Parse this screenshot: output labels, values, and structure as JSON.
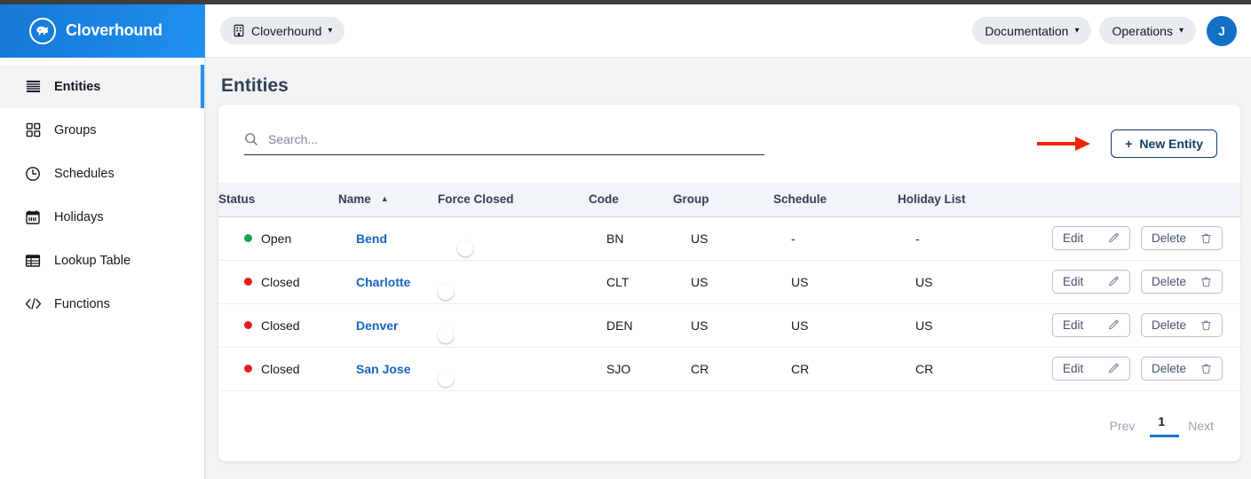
{
  "brand": {
    "name": "Cloverhound",
    "logo_icon": "hound-logo-icon"
  },
  "topbar": {
    "tenant": {
      "label": "Cloverhound",
      "icon": "building-icon",
      "chevron": "chevron-down-icon"
    },
    "documentation": {
      "label": "Documentation",
      "chevron": "chevron-down-icon"
    },
    "operations": {
      "label": "Operations",
      "chevron": "chevron-down-icon"
    },
    "avatar": {
      "initial": "J",
      "color": "#1370c4"
    }
  },
  "sidebar": {
    "items": [
      {
        "label": "Entities",
        "icon": "list-stack-icon",
        "active": true
      },
      {
        "label": "Groups",
        "icon": "grid-squares-icon",
        "active": false
      },
      {
        "label": "Schedules",
        "icon": "clock-icon",
        "active": false
      },
      {
        "label": "Holidays",
        "icon": "calendar-icon",
        "active": false
      },
      {
        "label": "Lookup Table",
        "icon": "table-icon",
        "active": false
      },
      {
        "label": "Functions",
        "icon": "code-brackets-icon",
        "active": false
      }
    ]
  },
  "main": {
    "page_title": "Entities",
    "search": {
      "placeholder": "Search...",
      "value": "",
      "icon": "search-icon"
    },
    "new_entity_button": {
      "label": "New Entity",
      "plus": "+",
      "icon": "plus-icon"
    },
    "annotation": {
      "type": "red-arrow",
      "color": "#ee2400",
      "points_to": "New Entity"
    },
    "table": {
      "columns": [
        {
          "key": "status",
          "label": "Status"
        },
        {
          "key": "name",
          "label": "Name",
          "sorted": "asc",
          "sort_glyph": "▲"
        },
        {
          "key": "force_closed",
          "label": "Force Closed"
        },
        {
          "key": "code",
          "label": "Code"
        },
        {
          "key": "group",
          "label": "Group"
        },
        {
          "key": "schedule",
          "label": "Schedule"
        },
        {
          "key": "holiday_list",
          "label": "Holiday List"
        }
      ],
      "rows": [
        {
          "status": "Open",
          "status_color": "#16a34a",
          "name": "Bend",
          "force_closed": false,
          "code": "BN",
          "group": "US",
          "schedule": "-",
          "holiday_list": "-",
          "edit_label": "Edit",
          "delete_label": "Delete"
        },
        {
          "status": "Closed",
          "status_color": "#e11d1d",
          "name": "Charlotte",
          "force_closed": true,
          "code": "CLT",
          "group": "US",
          "schedule": "US",
          "holiday_list": "US",
          "edit_label": "Edit",
          "delete_label": "Delete"
        },
        {
          "status": "Closed",
          "status_color": "#e11d1d",
          "name": "Denver",
          "force_closed": true,
          "code": "DEN",
          "group": "US",
          "schedule": "US",
          "holiday_list": "US",
          "edit_label": "Edit",
          "delete_label": "Delete"
        },
        {
          "status": "Closed",
          "status_color": "#e11d1d",
          "name": "San Jose",
          "force_closed": true,
          "code": "SJO",
          "group": "CR",
          "schedule": "CR",
          "holiday_list": "CR",
          "edit_label": "Edit",
          "delete_label": "Delete"
        }
      ]
    },
    "pagination": {
      "prev": "Prev",
      "current": "1",
      "next": "Next"
    }
  },
  "colors": {
    "brand_blue": "#1f90f0",
    "link_blue": "#1565c0",
    "toggle_on": "#1565c0",
    "toggle_off": "#55606e",
    "accent_navy": "#123a6b"
  }
}
